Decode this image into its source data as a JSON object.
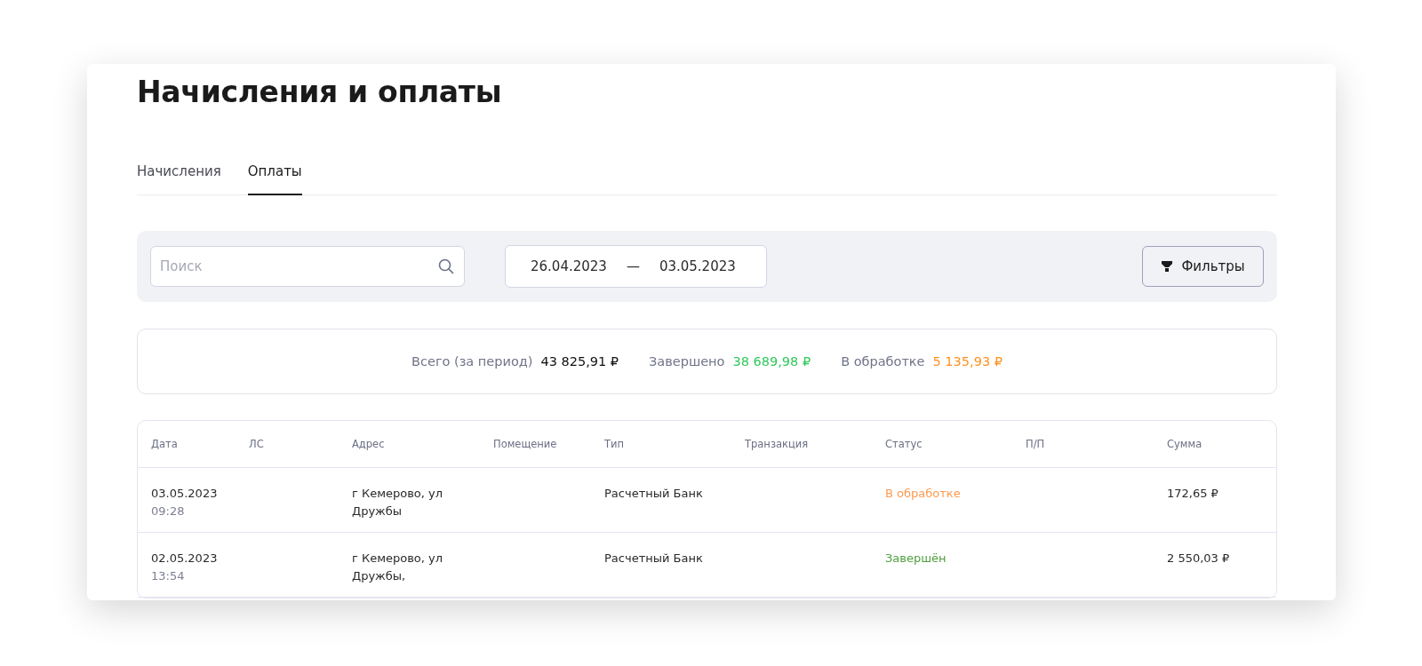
{
  "page": {
    "title": "Начисления и оплаты"
  },
  "tabs": [
    {
      "label": "Начисления",
      "selected": false
    },
    {
      "label": "Оплаты",
      "selected": true
    }
  ],
  "search": {
    "placeholder": "Поиск"
  },
  "date_range": {
    "from": "26.04.2023",
    "separator": "—",
    "to": "03.05.2023"
  },
  "filters_button": {
    "label": "Фильтры"
  },
  "summary": [
    {
      "label": "Всего (за период)",
      "value": "43 825,91 ₽",
      "kind": "total"
    },
    {
      "label": "Завершено",
      "value": "38 689,98 ₽",
      "kind": "done"
    },
    {
      "label": "В обработке",
      "value": "5 135,93 ₽",
      "kind": "processing"
    }
  ],
  "table": {
    "columns": [
      "Дата",
      "ЛС",
      "Адрес",
      "Помещение",
      "Тип",
      "Транзакция",
      "Статус",
      "П/П",
      "Сумма"
    ],
    "rows": [
      {
        "date": "03.05.2023",
        "time": "09:28",
        "address": "г Кемерово, ул Дружбы",
        "type": "Расчетный Банк",
        "status": {
          "text": "В обработке",
          "kind": "processing"
        },
        "amount": "172,65 ₽"
      },
      {
        "date": "02.05.2023",
        "time": "13:54",
        "address": "г Кемерово, ул Дружбы,",
        "type": "Расчетный Банк",
        "status": {
          "text": "Завершён",
          "kind": "done"
        },
        "amount": "2 550,03 ₽"
      }
    ]
  }
}
